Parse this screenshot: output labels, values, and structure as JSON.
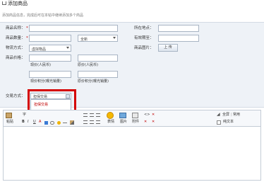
{
  "header": {
    "title": "添加商品",
    "subtitle": "添加商品信息，完成后可在本帖中继续添加多个商品"
  },
  "form": {
    "name_label": "商品名称：",
    "quantity_label": "商品数量：",
    "quantity_unit": "全新",
    "delivery_label": "物流方式：",
    "delivery_value": "虚拟物品",
    "price_label": "商品价格：",
    "my_price_caption": "现价(人民币)",
    "orig_price_caption": "原价(人民币)",
    "my_points_caption": "现价积分(曝光销量)",
    "orig_points_caption": "原价积分(曝光销量)",
    "location_label": "所在地点：",
    "validity_label": "有效期至：",
    "image_label": "商品图片：",
    "upload_button": "上 传",
    "trade_label": "交易方式：",
    "trade_value": "担保交易",
    "trade_options": [
      "担保交易"
    ],
    "required_mark": "*"
  },
  "editor": {
    "font_label": "字",
    "paste_label": "粘贴",
    "emoji_label": "表情",
    "image_label": "图片",
    "attach_label": "附件",
    "fullscreen_label": "全屏",
    "common_label": "常用",
    "plaintext_label": "纯文本",
    "colors": {
      "red": "#c00000",
      "border": "#c4ccd6"
    }
  }
}
